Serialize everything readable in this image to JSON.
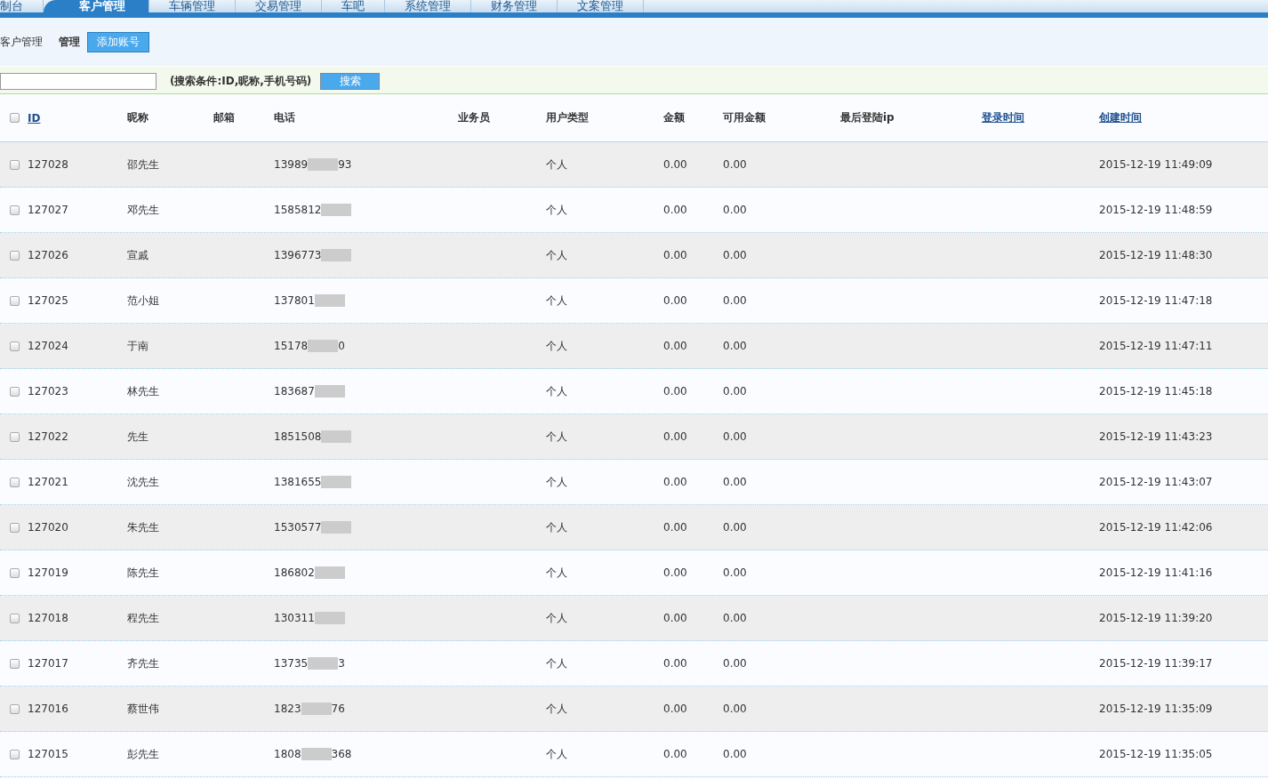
{
  "nav_tabs": [
    {
      "label": "制台",
      "selected": false
    },
    {
      "label": "客户管理",
      "selected": true
    },
    {
      "label": "车辆管理",
      "selected": false
    },
    {
      "label": "交易管理",
      "selected": false
    },
    {
      "label": "车吧",
      "selected": false
    },
    {
      "label": "系统管理",
      "selected": false
    },
    {
      "label": "财务管理",
      "selected": false
    },
    {
      "label": "文案管理",
      "selected": false
    }
  ],
  "breadcrumb": {
    "section": "客户管理",
    "current": "管理",
    "add_button": "添加账号"
  },
  "search": {
    "hint": "(搜索条件:ID,昵称,手机号码)",
    "button": "搜索"
  },
  "table": {
    "select_all_checked": false,
    "columns": [
      {
        "label": "ID",
        "kind": "link"
      },
      {
        "label": "昵称",
        "kind": "text"
      },
      {
        "label": "邮箱",
        "kind": "text"
      },
      {
        "label": "电话",
        "kind": "text"
      },
      {
        "label": "业务员",
        "kind": "text"
      },
      {
        "label": "用户类型",
        "kind": "text"
      },
      {
        "label": "金额",
        "kind": "text"
      },
      {
        "label": "可用金额",
        "kind": "text"
      },
      {
        "label": "最后登陆ip",
        "kind": "text"
      },
      {
        "label": "登录时间",
        "kind": "link"
      },
      {
        "label": "创建时间",
        "kind": "link"
      }
    ],
    "rows": [
      {
        "checked": false,
        "id": "127028",
        "name": "邵先生",
        "phone_start": "13989",
        "phone_end": "93",
        "type": "个人",
        "amount": "0.00",
        "available": "0.00",
        "created": "2015-12-19 11:49:09"
      },
      {
        "checked": false,
        "id": "127027",
        "name": "邓先生",
        "phone_start": "1585812",
        "phone_end": "",
        "type": "个人",
        "amount": "0.00",
        "available": "0.00",
        "created": "2015-12-19 11:48:59"
      },
      {
        "checked": false,
        "id": "127026",
        "name": "宣戚",
        "phone_start": "1396773",
        "phone_end": "",
        "type": "个人",
        "amount": "0.00",
        "available": "0.00",
        "created": "2015-12-19 11:48:30"
      },
      {
        "checked": false,
        "id": "127025",
        "name": "范小姐",
        "phone_start": "137801",
        "phone_end": "",
        "type": "个人",
        "amount": "0.00",
        "available": "0.00",
        "created": "2015-12-19 11:47:18"
      },
      {
        "checked": false,
        "id": "127024",
        "name": "于南",
        "phone_start": "15178",
        "phone_end": "0",
        "type": "个人",
        "amount": "0.00",
        "available": "0.00",
        "created": "2015-12-19 11:47:11"
      },
      {
        "checked": false,
        "id": "127023",
        "name": "林先生",
        "phone_start": "183687",
        "phone_end": "",
        "type": "个人",
        "amount": "0.00",
        "available": "0.00",
        "created": "2015-12-19 11:45:18"
      },
      {
        "checked": false,
        "id": "127022",
        "name": "先生",
        "phone_start": "1851508",
        "phone_end": "",
        "type": "个人",
        "amount": "0.00",
        "available": "0.00",
        "created": "2015-12-19 11:43:23"
      },
      {
        "checked": false,
        "id": "127021",
        "name": "沈先生",
        "phone_start": "1381655",
        "phone_end": "",
        "type": "个人",
        "amount": "0.00",
        "available": "0.00",
        "created": "2015-12-19 11:43:07"
      },
      {
        "checked": false,
        "id": "127020",
        "name": "朱先生",
        "phone_start": "1530577",
        "phone_end": "",
        "type": "个人",
        "amount": "0.00",
        "available": "0.00",
        "created": "2015-12-19 11:42:06"
      },
      {
        "checked": false,
        "id": "127019",
        "name": "陈先生",
        "phone_start": "186802",
        "phone_end": "",
        "type": "个人",
        "amount": "0.00",
        "available": "0.00",
        "created": "2015-12-19 11:41:16"
      },
      {
        "checked": false,
        "id": "127018",
        "name": "程先生",
        "phone_start": "130311",
        "phone_end": "",
        "type": "个人",
        "amount": "0.00",
        "available": "0.00",
        "created": "2015-12-19 11:39:20"
      },
      {
        "checked": false,
        "id": "127017",
        "name": "齐先生",
        "phone_start": "13735",
        "phone_end": "3",
        "type": "个人",
        "amount": "0.00",
        "available": "0.00",
        "created": "2015-12-19 11:39:17"
      },
      {
        "checked": false,
        "id": "127016",
        "name": "蔡世伟",
        "phone_start": "1823",
        "phone_end": "76",
        "type": "个人",
        "amount": "0.00",
        "available": "0.00",
        "created": "2015-12-19 11:35:09"
      },
      {
        "checked": false,
        "id": "127015",
        "name": "彭先生",
        "phone_start": "1808",
        "phone_end": "368",
        "type": "个人",
        "amount": "0.00",
        "available": "0.00",
        "created": "2015-12-19 11:35:05"
      }
    ]
  }
}
